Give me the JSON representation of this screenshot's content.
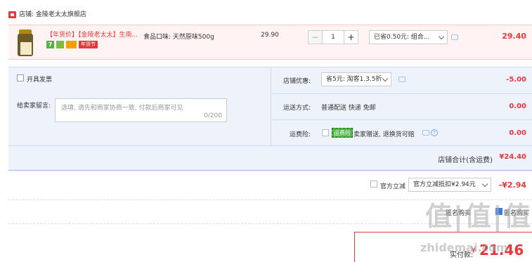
{
  "shop": {
    "icon": "shop-icon",
    "label": "店铺: 金陵老太太旗舰店"
  },
  "item": {
    "title": "【年货价】【金陵老太太】生南...",
    "spec": "食品口味: 天然原味500g",
    "badges": {
      "seven_day": "7",
      "new_year": "年货节"
    },
    "unit_price": "29.90",
    "qty_minus": "−",
    "qty": "1",
    "qty_plus": "+",
    "promo": "已省0.50元: 组合...",
    "total": "29.40"
  },
  "options": {
    "invoice_label": "开具发票",
    "message_label": "给卖家留言:",
    "message_placeholder": "选填, 请先和商家协商一致, 付款后商家可见",
    "message_count": "0/200",
    "shop_discount_label": "店铺优惠:",
    "shop_discount_value": "省5元: 淘客1.3.5折",
    "shop_discount_amount": "-5.00",
    "shipping_label": "运送方式:",
    "shipping_value": "普通配送 快递 免邮",
    "shipping_amount": "0.00",
    "insurance_label": "运费险:",
    "insurance_badge": "运费险",
    "insurance_text": "卖家赠送, 退换货可赔",
    "insurance_amount": "0.00",
    "help": "?",
    "shop_total_label": "店铺合计(含运费)",
    "shop_total_value": "¥24.40"
  },
  "official": {
    "label": "官方立减",
    "select": "官方立减抵扣¥2.94元",
    "amount": "-¥2.94"
  },
  "anon": {
    "label_left": "匿名购买",
    "label_right": "匿名购买"
  },
  "pay": {
    "label": "实付款:",
    "currency": "¥",
    "amount": "21.46"
  },
  "watermark": {
    "logo": "值|值|值",
    "text": "zhidemai.com"
  },
  "colors": {
    "accent": "#e4393c",
    "block_bg": "#eef3fb",
    "item_bg": "#fff3f3"
  }
}
